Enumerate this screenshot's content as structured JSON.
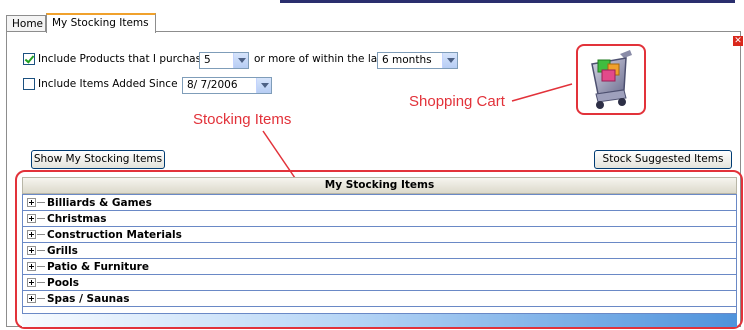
{
  "tabs": [
    {
      "label": "Home",
      "active": false
    },
    {
      "label": "My Stocking Items",
      "active": true
    }
  ],
  "filters": {
    "include_purchased": {
      "checked": true,
      "label": "Include Products that I purchased",
      "quantity": "5",
      "middle_label": "or more of within the last",
      "period": "6 months"
    },
    "include_added": {
      "checked": false,
      "label": "Include Items Added Since",
      "date": "8/ 7/2006"
    }
  },
  "buttons": {
    "show": "Show My Stocking Items",
    "stock_suggested": "Stock Suggested Items"
  },
  "annotations": {
    "cart": "Shopping Cart",
    "stocking": "Stocking Items"
  },
  "grid": {
    "header": "My Stocking Items",
    "items": [
      {
        "label": "Billiards & Games"
      },
      {
        "label": "Christmas"
      },
      {
        "label": "Construction Materials"
      },
      {
        "label": "Grills"
      },
      {
        "label": "Patio & Furniture"
      },
      {
        "label": "Pools"
      },
      {
        "label": "Spas / Saunas"
      }
    ]
  },
  "colors": {
    "annotation": "#e2323a",
    "tab_accent": "#f0a12c",
    "grid_border": "#6a89c6"
  },
  "icons": {
    "close": "close-icon",
    "cart": "shopping-cart-icon"
  }
}
